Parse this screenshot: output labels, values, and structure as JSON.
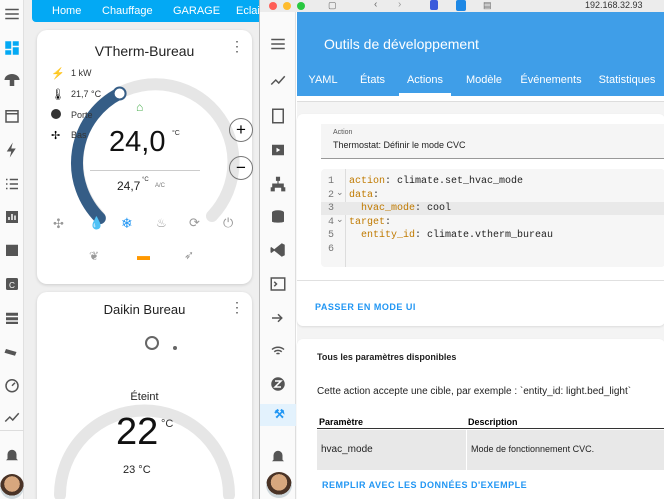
{
  "left": {
    "top_tabs": [
      "Home",
      "Chauffage",
      "GARAGE",
      "Eclai"
    ],
    "card1": {
      "title": "VTherm-Bureau",
      "rows": [
        {
          "icon": "flash-icon",
          "text": "1 kW"
        },
        {
          "icon": "thermometer-icon",
          "text": "21,7 °C"
        },
        {
          "icon": "window-icon",
          "text": "Porte"
        },
        {
          "icon": "fan-icon",
          "text": "Bas"
        }
      ],
      "setpoint": "24,0",
      "setpoint_unit": "°C",
      "current": "24,7",
      "current_unit": "°C",
      "mode_label": "A/C",
      "plus": "+",
      "minus": "−",
      "gauge_fraction": 0.4
    },
    "card2": {
      "title": "Daikin Bureau",
      "state": "Éteint",
      "setpoint": "22",
      "unit": "°C",
      "current": "23 °C"
    }
  },
  "browser": {
    "url": "192.168.32.93"
  },
  "right": {
    "header_title": "Outils de développement",
    "tabs": [
      "YAML",
      "États",
      "Actions",
      "Modèle",
      "Événements",
      "Statistiques"
    ],
    "active_tab": "Actions",
    "action_label": "Action",
    "action_value": "Thermostat: Définir le mode CVC",
    "code_lines": [
      {
        "n": "1",
        "k": "action",
        "v": " climate.set_hvac_mode",
        "fold": false
      },
      {
        "n": "2",
        "k": "data",
        "v": "",
        "fold": true
      },
      {
        "n": "3",
        "k": "  hvac_mode",
        "v": " cool",
        "fold": false
      },
      {
        "n": "4",
        "k": "target",
        "v": "",
        "fold": true
      },
      {
        "n": "5",
        "k": "  entity_id",
        "v": " climate.vtherm_bureau",
        "fold": false
      },
      {
        "n": "6",
        "k": "",
        "v": "",
        "fold": false
      }
    ],
    "switch_ui": "PASSER EN MODE UI",
    "params_title": "Tous les paramètres disponibles",
    "params_desc": "Cette action accepte une cible, par exemple : `entity_id: light.bed_light`",
    "table_headers": [
      "Paramètre",
      "Description"
    ],
    "table_rows": [
      [
        "hvac_mode",
        "Mode de fonctionnement CVC."
      ]
    ],
    "fill_btn": "REMPLIR AVEC LES DONNÉES D'EXEMPLE"
  },
  "colors": {
    "primary": "#03a9f4",
    "header": "#3f9ee8",
    "accent": "#2196f3",
    "gauge": "#355d86",
    "orange": "#ff9800",
    "green": "#4caf50"
  }
}
